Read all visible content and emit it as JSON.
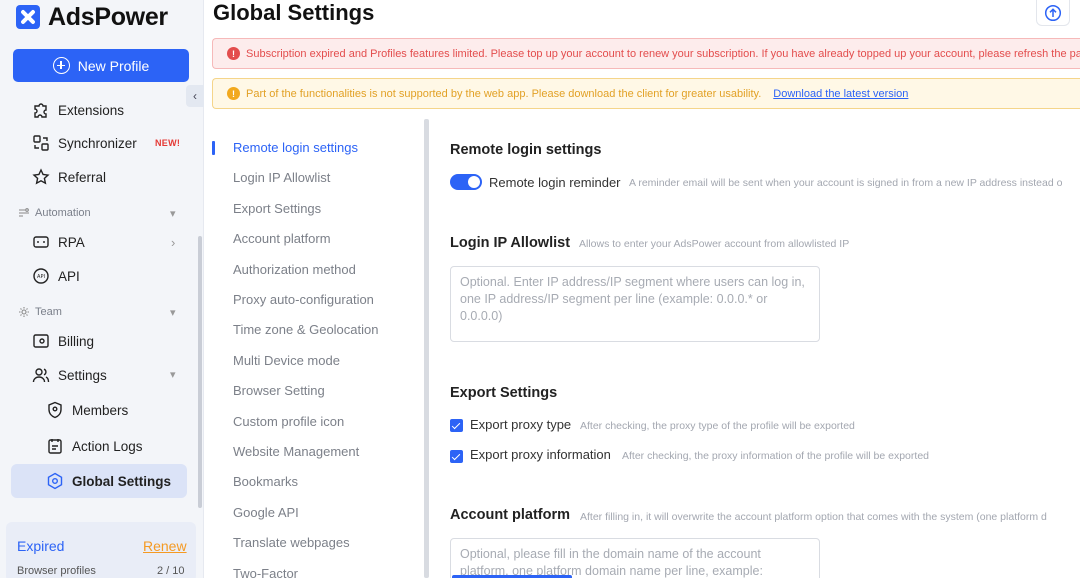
{
  "app": {
    "name": "AdsPower"
  },
  "sidebar": {
    "new_profile_label": "New Profile",
    "items": [
      {
        "label": "Extensions",
        "icon": "puzzle-icon"
      },
      {
        "label": "Synchronizer",
        "icon": "sync-icon",
        "badge": "NEW!"
      },
      {
        "label": "Referral",
        "icon": "star-icon"
      }
    ],
    "automation_section": "Automation",
    "automation_items": [
      {
        "label": "RPA",
        "icon": "robot-icon"
      },
      {
        "label": "API",
        "icon": "api-icon"
      }
    ],
    "team_section": "Team",
    "team_items": [
      {
        "label": "Billing",
        "icon": "billing-icon"
      },
      {
        "label": "Settings",
        "icon": "users-icon"
      }
    ],
    "settings_sub_items": [
      {
        "label": "Members",
        "icon": "shield-icon"
      },
      {
        "label": "Action Logs",
        "icon": "log-icon"
      },
      {
        "label": "Global Settings",
        "icon": "hexagon-icon",
        "active": true
      }
    ],
    "footer": {
      "status": "Expired",
      "renew": "Renew",
      "browser_profiles_label": "Browser profiles",
      "browser_profiles_count": "2 / 10"
    }
  },
  "header": {
    "title": "Global Settings"
  },
  "alerts": {
    "error": "Subscription expired and Profiles features limited. Please top up your account to renew your subscription. If you have already topped up your account, please refresh the pa",
    "warning": "Part of the functionalities is not supported by the web app. Please download the client for greater usability.",
    "warning_link": "Download the latest version"
  },
  "settings_nav": [
    "Remote login settings",
    "Login IP Allowlist",
    "Export Settings",
    "Account platform",
    "Authorization method",
    "Proxy auto-configuration",
    "Time zone & Geolocation",
    "Multi Device mode",
    "Browser Setting",
    "Custom profile icon",
    "Website Management",
    "Bookmarks",
    "Google API",
    "Translate webpages",
    "Two-Factor"
  ],
  "content": {
    "remote_login": {
      "title": "Remote login settings",
      "toggle_label": "Remote login reminder",
      "toggle_on": true,
      "hint": "A reminder email will be sent when your account is signed in from a new IP address instead o"
    },
    "ip_allowlist": {
      "title": "Login IP Allowlist",
      "hint": "Allows to enter your AdsPower account from allowlisted IP",
      "placeholder": "Optional. Enter IP address/IP segment where users can log in, one IP address/IP segment per line (example: 0.0.0.* or 0.0.0.0)"
    },
    "export": {
      "title": "Export Settings",
      "options": [
        {
          "label": "Export proxy type",
          "hint": "After checking, the proxy type of the profile will be exported",
          "checked": true
        },
        {
          "label": "Export proxy information",
          "hint": "After checking, the proxy information of the profile will be exported",
          "checked": true
        }
      ]
    },
    "account_platform": {
      "title": "Account platform",
      "hint": "After filling in, it will overwrite the account platform option that comes with the system (one platform d",
      "placeholder": "Optional, please fill in the domain name of the account platform, one platform domain name per line, example:"
    }
  },
  "colors": {
    "accent": "#2c63f6",
    "error": "#e34d4d",
    "warning": "#f2a91e",
    "new_badge": "#e53935"
  }
}
